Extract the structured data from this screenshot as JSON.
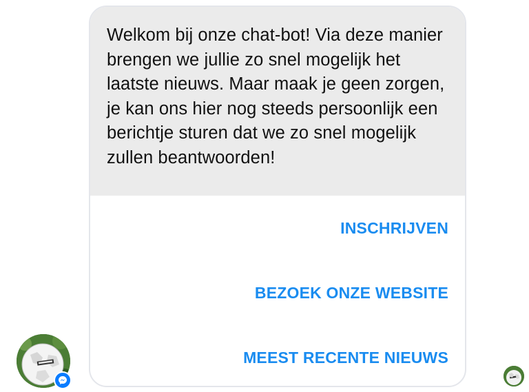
{
  "bot_message": {
    "text": "Welkom bij onze chat-bot! Via deze manier brengen we jullie zo snel mogelijk het laatste nieuws. Maar maak je geen zorgen, je kan ons hier nog steeds persoonlijk een berichtje sturen dat we zo snel mogelijk zullen beantwoorden!"
  },
  "quick_replies": [
    {
      "label": "INSCHRIJVEN"
    },
    {
      "label": "BEZOEK ONZE WEBSITE"
    },
    {
      "label": "MEEST RECENTE NIEUWS"
    }
  ],
  "sender": {
    "avatar_icon": "soccer-ball-avatar",
    "badge_icon": "messenger-icon"
  },
  "seen_indicator": {
    "avatar_icon": "soccer-ball-avatar"
  },
  "colors": {
    "bubble_bg": "#ebebeb",
    "action_text": "#1a8cf0",
    "messenger_badge": "#0a7cff"
  }
}
